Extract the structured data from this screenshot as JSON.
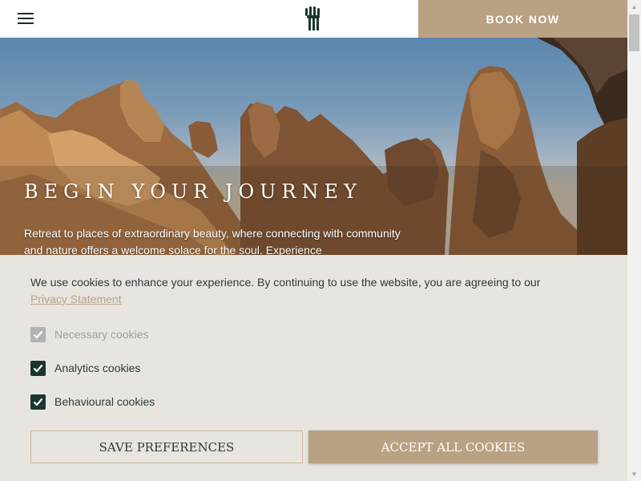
{
  "header": {
    "menu_icon": "hamburger-menu-icon",
    "logo_icon": "banyan-tree-logo-icon",
    "book_now_label": "BOOK NOW"
  },
  "hero": {
    "title": "BEGIN YOUR JOURNEY",
    "text": "Retreat to places of extraordinary beauty, where connecting with community and nature offers a welcome solace for the soul. Experience"
  },
  "cookies": {
    "message": "We use cookies to enhance your experience. By continuing to use the website, you are agreeing to our ",
    "privacy_link": "Privacy Statement",
    "options": [
      {
        "label": "Necessary cookies",
        "checked": true,
        "disabled": true
      },
      {
        "label": "Analytics cookies",
        "checked": true,
        "disabled": false
      },
      {
        "label": "Behavioural cookies",
        "checked": true,
        "disabled": false
      }
    ],
    "save_label": "SAVE PREFERENCES",
    "accept_label": "ACCEPT ALL COOKIES"
  },
  "colors": {
    "accent": "#b8a283",
    "dark_green": "#1b3530",
    "panel_bg": "#e8e5e0"
  }
}
